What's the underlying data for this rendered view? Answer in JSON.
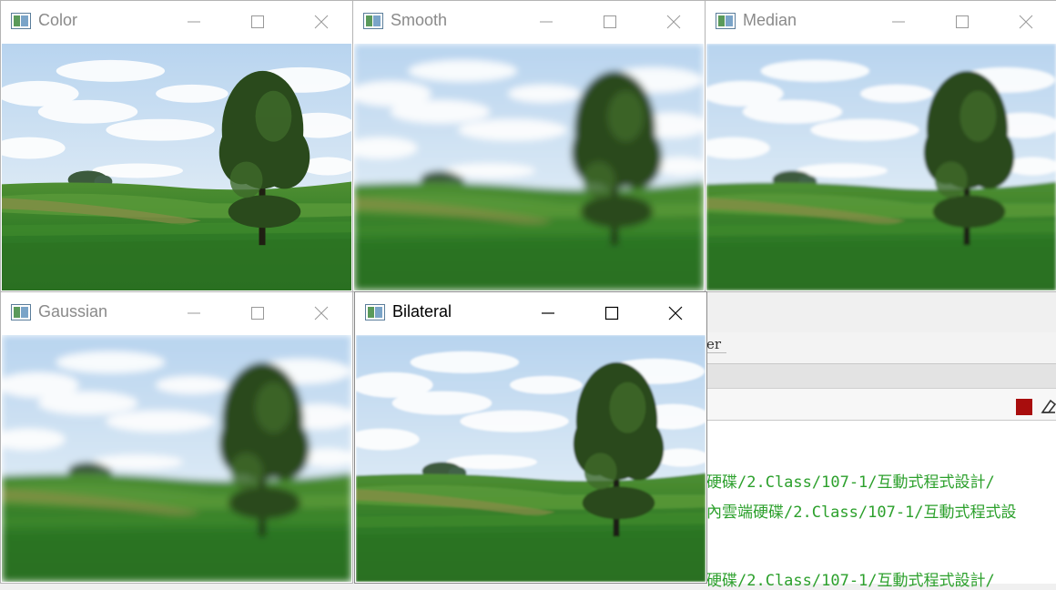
{
  "windows": [
    {
      "id": "color",
      "title": "Color",
      "active": false,
      "filter": "none"
    },
    {
      "id": "smooth",
      "title": "Smooth",
      "active": false,
      "filter": "blur"
    },
    {
      "id": "median",
      "title": "Median",
      "active": false,
      "filter": "median"
    },
    {
      "id": "gaussian",
      "title": "Gaussian",
      "active": false,
      "filter": "blur"
    },
    {
      "id": "bilateral",
      "title": "Bilateral",
      "active": true,
      "filter": "bilateral"
    }
  ],
  "ide": {
    "tab_label": "er",
    "console_lines": [
      "硬碟/2.Class/107-1/互動式程式設計/",
      "內雲端硬碟/2.Class/107-1/互動式程式設",
      "硬碟/2.Class/107-1/互動式程式設計/"
    ],
    "colors": {
      "console_text": "#2ca02c",
      "stop": "#a80d0d"
    }
  },
  "icons": {
    "app": "opencv-window-icon",
    "minimize": "minimize-icon",
    "maximize": "maximize-icon",
    "close": "close-icon",
    "stop": "stop-icon",
    "clear": "clear-console-icon"
  }
}
